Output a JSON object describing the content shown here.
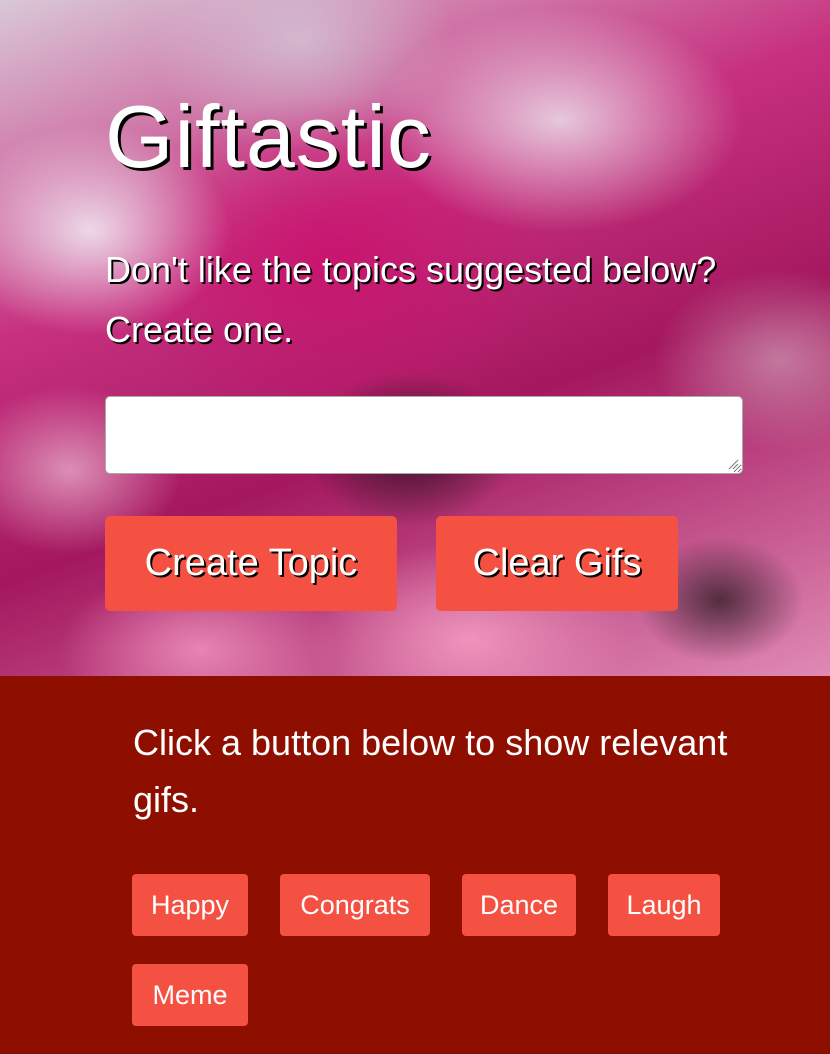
{
  "hero": {
    "title": "Giftastic",
    "prompt": "Don't like the topics suggested below? Create one.",
    "input_value": "",
    "create_button": "Create Topic",
    "clear_button": "Clear Gifs"
  },
  "topics": {
    "instruction": "Click a button below to show relevant gifs.",
    "buttons": [
      "Happy",
      "Congrats",
      "Dance",
      "Laugh",
      "Meme"
    ]
  },
  "colors": {
    "button": "#f55142",
    "lower_background": "#8e0f00",
    "text": "#ffffff"
  }
}
